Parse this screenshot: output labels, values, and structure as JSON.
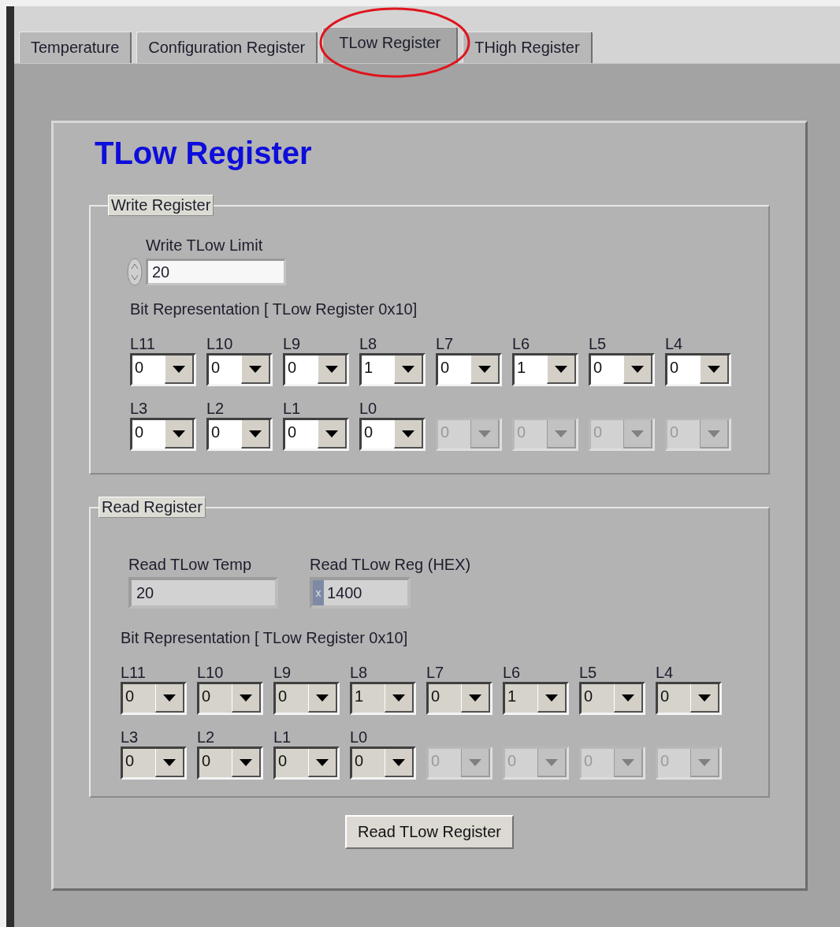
{
  "tabs": [
    {
      "label": "Temperature",
      "selected": false,
      "circled": false
    },
    {
      "label": "Configuration Register",
      "selected": false,
      "circled": false
    },
    {
      "label": "TLow Register",
      "selected": true,
      "circled": true
    },
    {
      "label": "THigh Register",
      "selected": false,
      "circled": false
    }
  ],
  "title": "TLow Register",
  "write_register": {
    "label": "Write Register",
    "limit": {
      "label": "Write TLow Limit",
      "value": "20"
    },
    "bits_label": "Bit Representation [ TLow Register 0x10]",
    "bits": [
      {
        "label": "L11",
        "value": "0",
        "disabled": false
      },
      {
        "label": "L10",
        "value": "0",
        "disabled": false
      },
      {
        "label": "L9",
        "value": "0",
        "disabled": false
      },
      {
        "label": "L8",
        "value": "1",
        "disabled": false
      },
      {
        "label": "L7",
        "value": "0",
        "disabled": false
      },
      {
        "label": "L6",
        "value": "1",
        "disabled": false
      },
      {
        "label": "L5",
        "value": "0",
        "disabled": false
      },
      {
        "label": "L4",
        "value": "0",
        "disabled": false
      },
      {
        "label": "L3",
        "value": "0",
        "disabled": false
      },
      {
        "label": "L2",
        "value": "0",
        "disabled": false
      },
      {
        "label": "L1",
        "value": "0",
        "disabled": false
      },
      {
        "label": "L0",
        "value": "0",
        "disabled": false
      },
      {
        "value": "0",
        "disabled": true
      },
      {
        "value": "0",
        "disabled": true
      },
      {
        "value": "0",
        "disabled": true
      },
      {
        "value": "0",
        "disabled": true
      }
    ]
  },
  "read_register": {
    "label": "Read Register",
    "temp": {
      "label": "Read TLow Temp",
      "value": "20"
    },
    "hex": {
      "label": "Read TLow Reg (HEX)",
      "radix": "x",
      "value": "1400"
    },
    "bits_label": "Bit Representation [ TLow Register 0x10]",
    "bits": [
      {
        "label": "L11",
        "value": "0",
        "disabled": false
      },
      {
        "label": "L10",
        "value": "0",
        "disabled": false
      },
      {
        "label": "L9",
        "value": "0",
        "disabled": false
      },
      {
        "label": "L8",
        "value": "1",
        "disabled": false
      },
      {
        "label": "L7",
        "value": "0",
        "disabled": false
      },
      {
        "label": "L6",
        "value": "1",
        "disabled": false
      },
      {
        "label": "L5",
        "value": "0",
        "disabled": false
      },
      {
        "label": "L4",
        "value": "0",
        "disabled": false
      },
      {
        "label": "L3",
        "value": "0",
        "disabled": false
      },
      {
        "label": "L2",
        "value": "0",
        "disabled": false
      },
      {
        "label": "L1",
        "value": "0",
        "disabled": false
      },
      {
        "label": "L0",
        "value": "0",
        "disabled": false
      },
      {
        "value": "0",
        "disabled": true
      },
      {
        "value": "0",
        "disabled": true
      },
      {
        "value": "0",
        "disabled": true
      },
      {
        "value": "0",
        "disabled": true
      }
    ]
  },
  "button": "Read TLow Register"
}
